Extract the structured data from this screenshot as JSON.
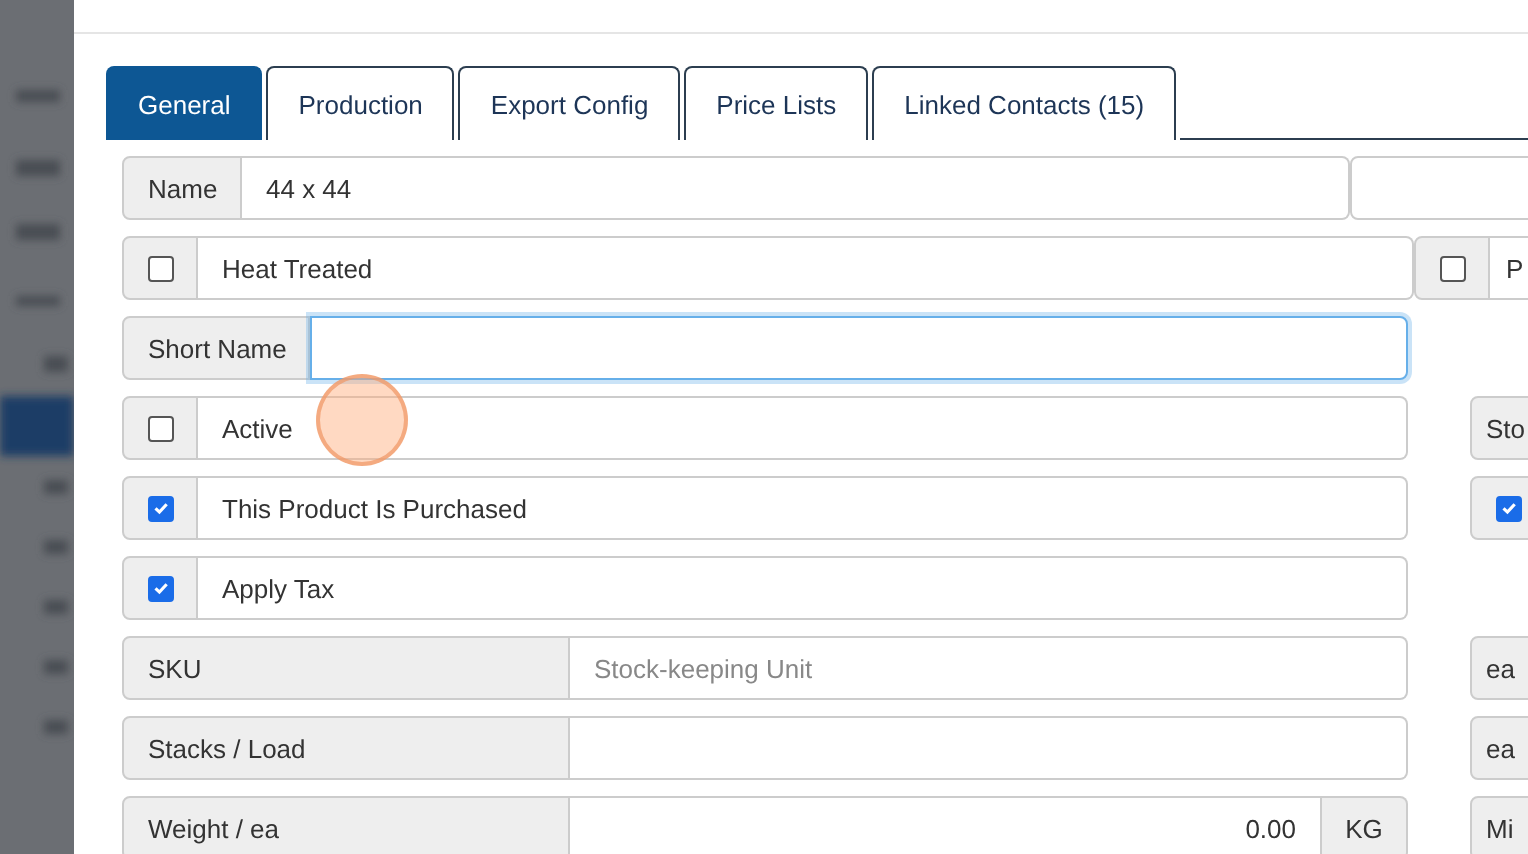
{
  "tabs": [
    {
      "label": "General",
      "selected": true
    },
    {
      "label": "Production",
      "selected": false
    },
    {
      "label": "Export Config",
      "selected": false
    },
    {
      "label": "Price Lists",
      "selected": false
    },
    {
      "label": "Linked Contacts (15)",
      "selected": false
    }
  ],
  "rows": [
    {
      "kind": "text",
      "label": "Name",
      "value": "44 x 44",
      "side": {
        "kind": "input"
      }
    },
    {
      "kind": "check",
      "label": "Heat Treated",
      "checked": false,
      "side": {
        "kind": "check-joined",
        "label": "P",
        "checked": false
      }
    },
    {
      "kind": "text",
      "label": "Short Name",
      "value": "",
      "focused": true
    },
    {
      "kind": "check",
      "label": "Active",
      "checked": false,
      "side": {
        "kind": "addon",
        "label": "Sto"
      }
    },
    {
      "kind": "check",
      "label": "This Product Is Purchased",
      "checked": true,
      "side": {
        "kind": "check",
        "checked": true
      }
    },
    {
      "kind": "check",
      "label": "Apply Tax",
      "checked": true
    },
    {
      "kind": "text",
      "label": "SKU",
      "placeholder": "Stock-keeping Unit",
      "side": {
        "kind": "addon",
        "label": "ea"
      }
    },
    {
      "kind": "text",
      "label": "Stacks / Load",
      "value": "",
      "side": {
        "kind": "addon",
        "label": "ea"
      }
    },
    {
      "kind": "text",
      "label": "Weight / ea",
      "value": "0.00",
      "unit": "KG",
      "side": {
        "kind": "addon",
        "label": "Mi"
      }
    }
  ]
}
